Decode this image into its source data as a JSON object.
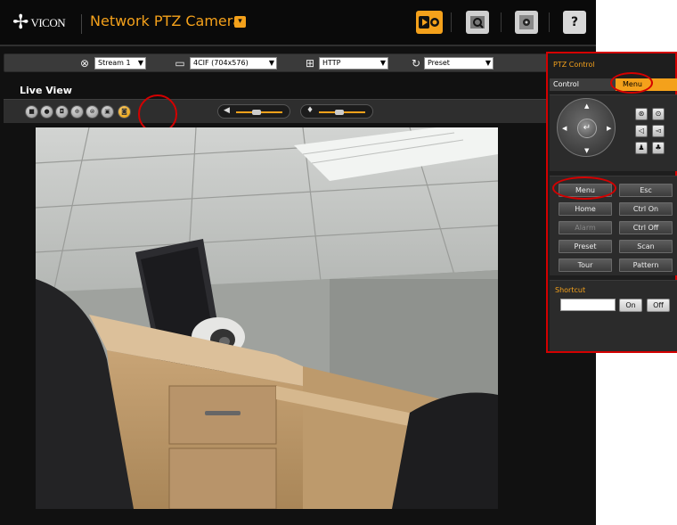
{
  "header": {
    "brand_text": "VICON",
    "app_title": "Network PTZ Camera",
    "top_icons": [
      "live-view-icon",
      "playback-search-icon",
      "setup-icon",
      "help-icon"
    ],
    "help_label": "?"
  },
  "selectors": {
    "stream": "Stream 1",
    "resolution": "4CIF (704x576)",
    "protocol": "HTTP",
    "preset": "Preset"
  },
  "live_view": {
    "label": "Live View",
    "toolbar_icons": [
      "snapshot-icon",
      "record-icon",
      "camera-icon",
      "zoom-in-icon",
      "fullscreen-icon",
      "window-icon",
      "digital-zoom-icon"
    ]
  },
  "ptz": {
    "title": "PTZ Control",
    "tabs": [
      "Control",
      "Menu"
    ],
    "menu_buttons": [
      [
        "Menu",
        "Esc"
      ],
      [
        "Home",
        "Ctrl On"
      ],
      [
        "Alarm",
        "Ctrl Off"
      ],
      [
        "Preset",
        "Scan"
      ],
      [
        "Tour",
        "Pattern"
      ]
    ],
    "shortcut_label": "Shortcut",
    "shortcut_value": "",
    "on_label": "On",
    "off_label": "Off"
  },
  "colors": {
    "accent": "#f4a11b",
    "highlight_ring": "#d40000"
  }
}
